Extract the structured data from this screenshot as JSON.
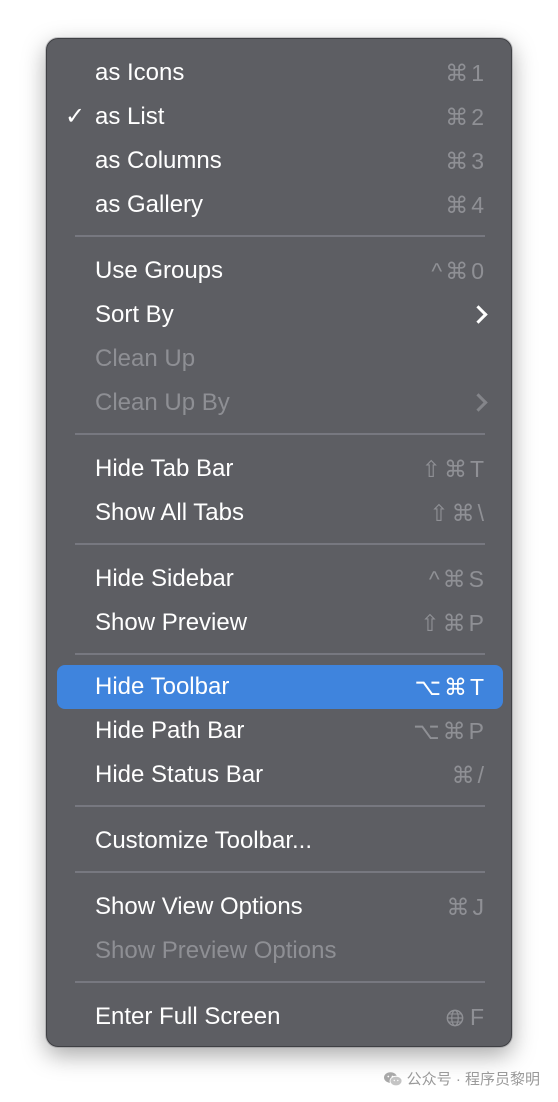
{
  "menu": {
    "items": [
      {
        "label": "as Icons",
        "shortcut": "⌘1",
        "checked": false,
        "disabled": false
      },
      {
        "label": "as List",
        "shortcut": "⌘2",
        "checked": true,
        "disabled": false
      },
      {
        "label": "as Columns",
        "shortcut": "⌘3",
        "checked": false,
        "disabled": false
      },
      {
        "label": "as Gallery",
        "shortcut": "⌘4",
        "checked": false,
        "disabled": false
      },
      {
        "label": "Use Groups",
        "shortcut": "^⌘0",
        "checked": false,
        "disabled": false
      },
      {
        "label": "Sort By",
        "shortcut": "",
        "submenu": true,
        "disabled": false
      },
      {
        "label": "Clean Up",
        "shortcut": "",
        "disabled": true
      },
      {
        "label": "Clean Up By",
        "shortcut": "",
        "submenu": true,
        "disabled": true
      },
      {
        "label": "Hide Tab Bar",
        "shortcut": "⇧⌘T",
        "disabled": false
      },
      {
        "label": "Show All Tabs",
        "shortcut": "⇧⌘\\",
        "disabled": false
      },
      {
        "label": "Hide Sidebar",
        "shortcut": "^⌘S",
        "disabled": false
      },
      {
        "label": "Show Preview",
        "shortcut": "⇧⌘P",
        "disabled": false
      },
      {
        "label": "Hide Toolbar",
        "shortcut": "⌥⌘T",
        "disabled": false,
        "highlighted": true
      },
      {
        "label": "Hide Path Bar",
        "shortcut": "⌥⌘P",
        "disabled": false
      },
      {
        "label": "Hide Status Bar",
        "shortcut": "⌘/",
        "disabled": false
      },
      {
        "label": "Customize Toolbar...",
        "shortcut": "",
        "disabled": false
      },
      {
        "label": "Show View Options",
        "shortcut": "⌘J",
        "disabled": false
      },
      {
        "label": "Show Preview Options",
        "shortcut": "",
        "disabled": true
      },
      {
        "label": "Enter Full Screen",
        "shortcut": "F",
        "shortcut_icon": "globe-icon",
        "disabled": false
      }
    ],
    "check_mark": "✓",
    "highlight_color": "#3f84dd",
    "background_color": "#5d5e63"
  },
  "watermark": {
    "text": "公众号 · 程序员黎明",
    "icon": "wechat-icon"
  }
}
